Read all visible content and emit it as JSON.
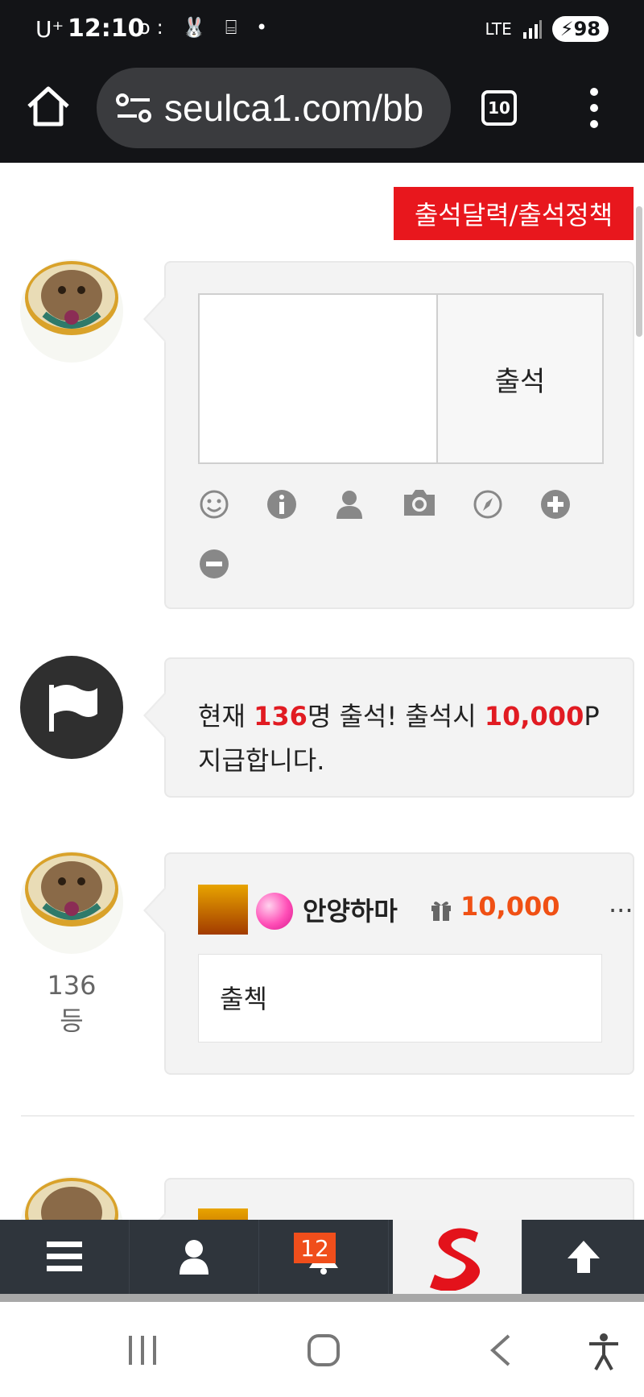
{
  "status_bar": {
    "carrier": "U⁺",
    "time": "12:10",
    "icons": "ᴏ: 🐰 ⌸ •",
    "network": "LTE",
    "battery": "98"
  },
  "browser": {
    "url": "seulca1.com/bb",
    "tab_count": "10"
  },
  "page": {
    "attendance_link": "출석달력/출석정책",
    "compose": {
      "submit_label": "출석"
    },
    "notice": {
      "prefix": "현재 ",
      "count": "136",
      "middle": "명 출석! 출석시 ",
      "points": "10,000",
      "suffix": "P",
      "line2": "지급합니다."
    },
    "entries": [
      {
        "rank": "136등",
        "nickname": "안양하마",
        "points": "10,000",
        "more": "...",
        "comment": "출첵"
      }
    ]
  },
  "bottom_nav": {
    "notification_count": "12"
  },
  "colors": {
    "accent_red": "#e8171d",
    "points_orange": "#f05014",
    "nav_bg": "#2f353c"
  }
}
